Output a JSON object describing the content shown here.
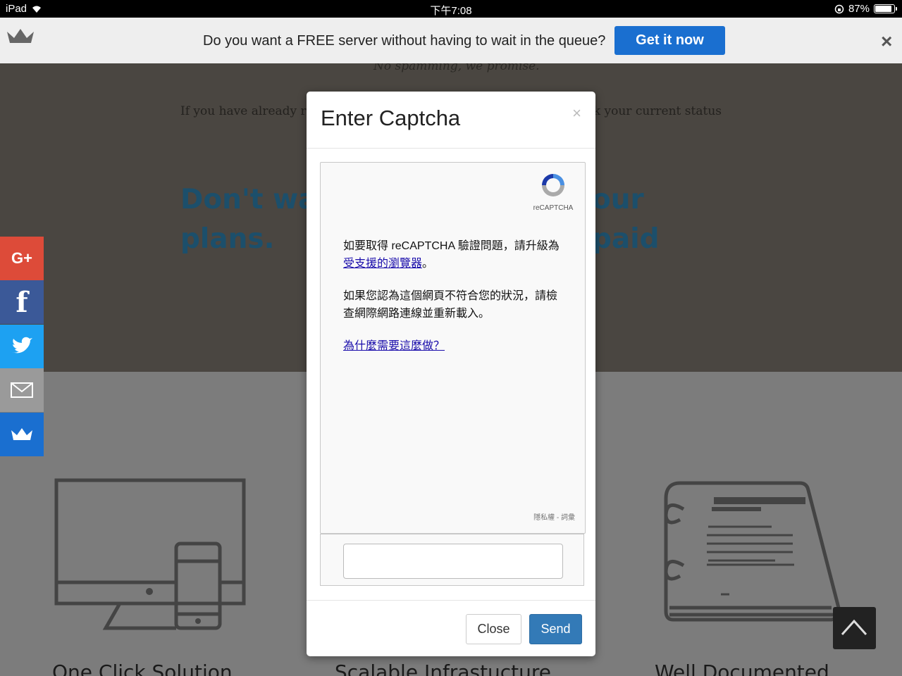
{
  "status_bar": {
    "device": "iPad",
    "time": "下午7:08",
    "battery": "87%",
    "battery_level": 0.87
  },
  "banner": {
    "message": "Do you want a FREE server without having to wait in the queue?",
    "cta": "Get it now",
    "close": "×"
  },
  "page": {
    "spam_note": "No spamming, we promise.",
    "already_left": "If you have already re",
    "already_right": "ck your current status",
    "promo_l1": "Don't wa",
    "promo_r1": "our paid",
    "promo_l2": "plans.",
    "features": [
      "One Click Solution",
      "Scalable Infrastucture",
      "Well Documented"
    ]
  },
  "social": [
    {
      "icon": "google-plus-icon",
      "label": "G+",
      "color": "#dd4b39"
    },
    {
      "icon": "facebook-icon",
      "label": "f",
      "color": "#3b5998"
    },
    {
      "icon": "twitter-icon",
      "label": "",
      "color": "#1da1f2"
    },
    {
      "icon": "email-icon",
      "label": "",
      "color": "#9a9a9a"
    },
    {
      "icon": "crown-icon",
      "label": "",
      "color": "#1a6fd0"
    }
  ],
  "modal": {
    "title": "Enter Captcha",
    "close": "×",
    "recaptcha": {
      "logo_label": "reCAPTCHA",
      "para1_pre": "如要取得 reCAPTCHA 驗證問題，請升級為",
      "para1_link": "受支援的瀏覽器",
      "para1_post": "。",
      "para2": "如果您認為這個網頁不符合您的狀況，請檢查網際網路連線並重新載入。",
      "why_link": "為什麼需要這麼做？",
      "footer": "隱私權 - 詞彙"
    },
    "input_value": "",
    "buttons": {
      "close": "Close",
      "send": "Send"
    }
  }
}
